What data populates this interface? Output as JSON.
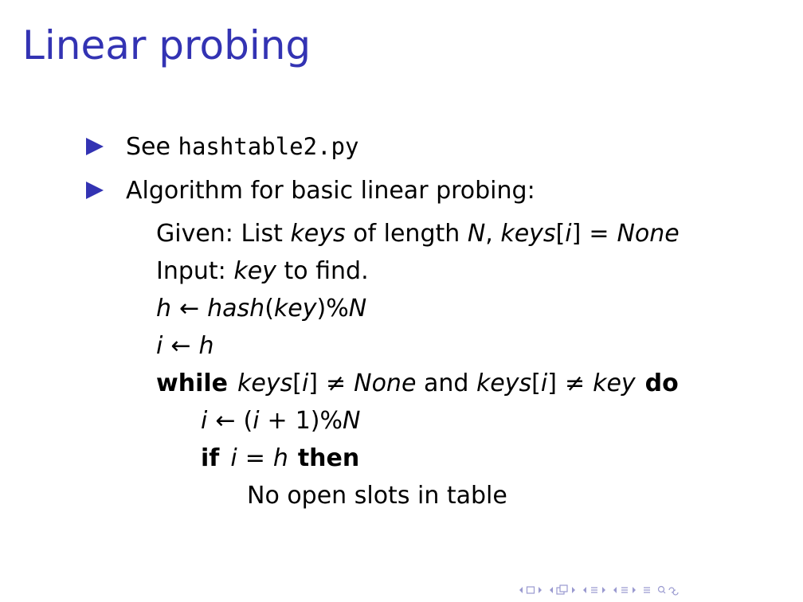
{
  "slide": {
    "title": "Linear probing",
    "bullets": [
      {
        "prefix": "See ",
        "code": "hashtable2.py"
      },
      {
        "text": "Algorithm for basic linear probing:"
      }
    ],
    "algorithm": {
      "given": {
        "w1": "Given: List ",
        "w2": "keys",
        "w3": " of length ",
        "w4": "N",
        "w5": ", ",
        "w6": "keys",
        "w7": "[",
        "w8": "i",
        "w9": "]",
        "w10": "=",
        "w11": "None"
      },
      "input": {
        "w1": "Input: ",
        "w2": "key",
        "w3": " to find."
      },
      "hash_line": {
        "w1": "h",
        "w2": "←",
        "w3": "hash",
        "w4": "(",
        "w5": "key",
        "w6": ")%",
        "w7": "N"
      },
      "i_line": {
        "w1": "i",
        "w2": "←",
        "w3": "h"
      },
      "while_line": {
        "w1": "while",
        "w2": "keys",
        "w3": "[",
        "w4": "i",
        "w5": "]",
        "w6": "≠",
        "w7": "None",
        "w8": " and ",
        "w9": "keys",
        "w10": "[",
        "w11": "i",
        "w12": "]",
        "w13": "≠",
        "w14": "key",
        "w15": "do"
      },
      "step_line": {
        "w1": "i",
        "w2": "←",
        "w3": "(",
        "w4": "i",
        "w5": "+",
        "w6": "1)%",
        "w7": "N"
      },
      "if_line": {
        "w1": "if",
        "w2": "i",
        "w3": "=",
        "w4": "h",
        "w5": "then"
      },
      "no_slots": "No open slots in table"
    }
  },
  "navigation": {
    "icons": [
      "nav-left-icon",
      "frame-icon",
      "nav-right-icon",
      "nav-left-icon",
      "subsection-icon",
      "nav-right-icon",
      "nav-left-icon",
      "section-icon",
      "nav-right-icon",
      "nav-left-icon",
      "section-icon",
      "nav-right-icon",
      "align-icon",
      "search-icon"
    ],
    "color": "#9a9ad0"
  },
  "colors": {
    "title": "#3333b3",
    "bullet": "#3333b3",
    "text": "#000000"
  }
}
